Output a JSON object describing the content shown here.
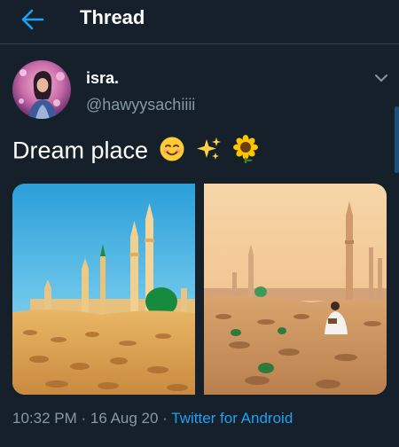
{
  "header": {
    "title": "Thread"
  },
  "author": {
    "name": "isra.",
    "handle": "@hawyysachiiii"
  },
  "tweet": {
    "text": "Dream place",
    "emojis": [
      "smiling-face-icon",
      "sparkles-icon",
      "sunflower-icon"
    ],
    "photos": [
      {
        "name": "mosque-photo-1"
      },
      {
        "name": "mosque-photo-2"
      }
    ],
    "time": "10:32 PM",
    "date": "16 Aug 20",
    "source": "Twitter for Android",
    "sep": " · "
  },
  "colors": {
    "background": "#15202b",
    "accent": "#1da1f2",
    "muted_text": "#8899a6",
    "divider": "#38444d"
  }
}
